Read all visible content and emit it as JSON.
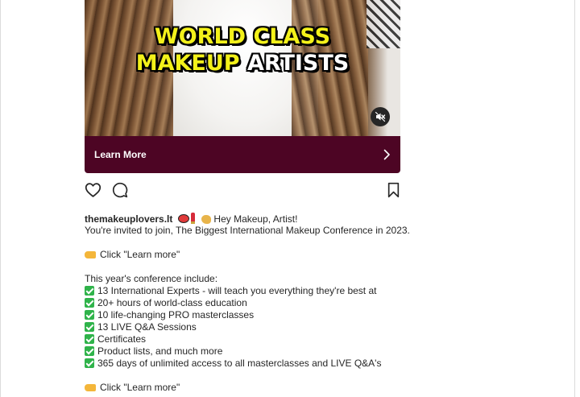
{
  "ad": {
    "headline_line1": "WORLD CLASS",
    "headline_line2_yellow": "MAKEUP",
    "headline_line2_white": "ARTISTS",
    "mute_icon": "speaker-muted-icon",
    "cta_label": "Learn More",
    "cta_icon": "chevron-right-icon",
    "cta_color": "#4d0524"
  },
  "actions": {
    "like_icon": "heart-icon",
    "comment_icon": "comment-icon",
    "save_icon": "bookmark-icon"
  },
  "caption": {
    "username": "themakeuplovers.lt",
    "greeting": "Hey Makeup, Artist!",
    "invite": "You're invited to join, The Biggest International Makeup Conference in 2023.",
    "click1": "Click \"Learn more\"",
    "include_heading": "This year's conference include:",
    "items": [
      "13 International Experts - will teach you everything they're best at",
      "20+ hours of world-class education",
      "10 life-changing PRO masterclasses",
      "13 LIVE Q&A Sessions",
      "Certificates",
      "Product lists, and much more",
      "365 days of unlimited access to all masterclasses and LIVE Q&A's"
    ],
    "click2": "Click \"Learn more\""
  }
}
